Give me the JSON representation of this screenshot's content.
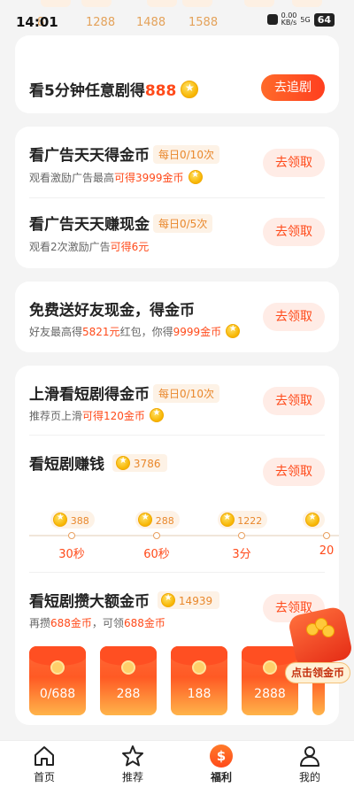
{
  "status_bar": {
    "time": "14:01",
    "net_speed_value": "0.00",
    "net_speed_unit": "KB/s",
    "signal": "5G",
    "battery": "64"
  },
  "top_strip": {
    "amounts": [
      "1288",
      "1488",
      "1588"
    ],
    "partial_amount": "8"
  },
  "card_watch5": {
    "title_prefix": "看5分钟任意剧得",
    "title_amount": "888",
    "button": "去追剧"
  },
  "card_ads": {
    "task1": {
      "title": "看广告天天得金币",
      "badge": "每日0/10次",
      "sub_prefix": "观看激励广告最高",
      "sub_highlight": "可得3999金币",
      "button": "去领取"
    },
    "task2": {
      "title": "看广告天天赚现金",
      "badge": "每日0/5次",
      "sub_prefix": "观看2次激励广告",
      "sub_highlight": "可得6元",
      "button": "去领取"
    }
  },
  "card_invite": {
    "title": "免费送好友现金，得金币",
    "sub_prefix": "好友最高得",
    "sub_hl1": "5821元",
    "sub_mid": "红包，你得",
    "sub_hl2": "9999金币",
    "button": "去领取"
  },
  "card_drama": {
    "swipe": {
      "title": "上滑看短剧得金币",
      "badge": "每日0/10次",
      "sub_prefix": "推荐页上滑",
      "sub_highlight": "可得120金币",
      "button": "去领取"
    },
    "earn": {
      "title": "看短剧赚钱",
      "coin_count": "3786",
      "button": "去领取",
      "milestones": [
        {
          "coins": "388",
          "label": "30秒"
        },
        {
          "coins": "288",
          "label": "60秒"
        },
        {
          "coins": "1222",
          "label": "3分"
        },
        {
          "coins": "",
          "label": "20"
        }
      ]
    },
    "save": {
      "title": "看短剧攒大额金币",
      "coin_count": "14939",
      "sub_prefix": "再攒",
      "sub_hl1": "688金币",
      "sub_mid": "，可领",
      "sub_hl2": "688金币",
      "button": "去领取",
      "packets": [
        "0/688",
        "288",
        "188",
        "2888"
      ]
    }
  },
  "floating": {
    "label": "点击领金币"
  },
  "tabbar": {
    "items": [
      {
        "label": "首页",
        "icon": "home-icon"
      },
      {
        "label": "推荐",
        "icon": "star-icon"
      },
      {
        "label": "福利",
        "icon": "money-icon"
      },
      {
        "label": "我的",
        "icon": "user-icon"
      }
    ],
    "active": "福利",
    "money_glyph": "$"
  }
}
